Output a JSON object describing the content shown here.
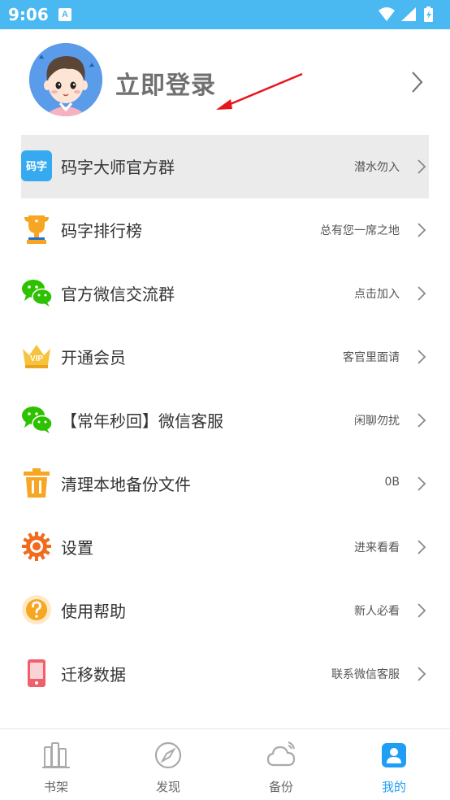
{
  "status_bar": {
    "time": "9:06",
    "notification_icon": "A"
  },
  "profile": {
    "login_label": "立即登录"
  },
  "menu": [
    {
      "label": "码字大师官方群",
      "value": "潜水勿入",
      "icon": "codeword-logo-icon",
      "icon_text": "码字"
    },
    {
      "label": "码字排行榜",
      "value": "总有您一席之地",
      "icon": "trophy-icon"
    },
    {
      "label": "官方微信交流群",
      "value": "点击加入",
      "icon": "wechat-icon"
    },
    {
      "label": "开通会员",
      "value": "客官里面请",
      "icon": "vip-crown-icon",
      "icon_text": "VIP"
    },
    {
      "label": "【常年秒回】微信客服",
      "value": "闲聊勿扰",
      "icon": "wechat-icon"
    },
    {
      "label": "清理本地备份文件",
      "value": "0B",
      "icon": "trash-icon"
    },
    {
      "label": "设置",
      "value": "进来看看",
      "icon": "gear-icon"
    },
    {
      "label": "使用帮助",
      "value": "新人必看",
      "icon": "help-icon"
    },
    {
      "label": "迁移数据",
      "value": "联系微信客服",
      "icon": "phone-migrate-icon"
    }
  ],
  "bottom_nav": [
    {
      "label": "书架",
      "icon": "bookshelf-icon",
      "active": false
    },
    {
      "label": "发现",
      "icon": "compass-icon",
      "active": false
    },
    {
      "label": "备份",
      "icon": "cloud-icon",
      "active": false
    },
    {
      "label": "我的",
      "icon": "profile-icon",
      "active": true
    }
  ],
  "colors": {
    "status_bar": "#4ab8f1",
    "accent": "#1e9ef4",
    "highlight_row": "#ebebeb",
    "wechat_green": "#2dc100",
    "trash_orange": "#f6a623",
    "gear_orange": "#f26b1d",
    "annotation_red": "#e8151b"
  }
}
